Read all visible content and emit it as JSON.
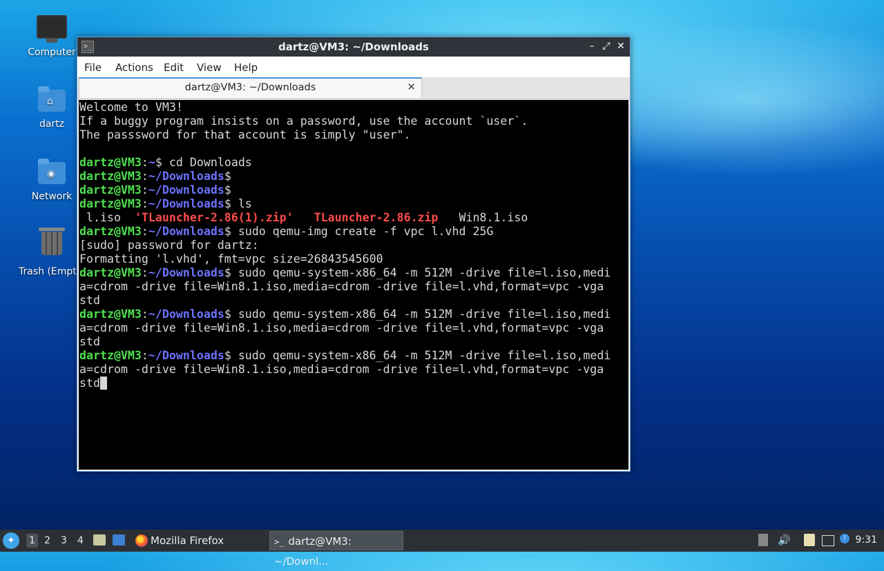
{
  "desktop": {
    "icons": [
      {
        "label": "Computer"
      },
      {
        "label": "dartz"
      },
      {
        "label": "Network"
      },
      {
        "label": "Trash (Empty)"
      }
    ]
  },
  "window": {
    "title": "dartz@VM3: ~/Downloads",
    "menu": [
      "File",
      "Actions",
      "Edit",
      "View",
      "Help"
    ],
    "tab_title": "dartz@VM3: ~/Downloads",
    "controls": {
      "minimize": "–",
      "maximize": "⤢",
      "close": "✕"
    }
  },
  "terminal": {
    "prompt_user": "dartz@VM3",
    "lines": [
      {
        "text": "Welcome to VM3!"
      },
      {
        "text": "If a buggy program insists on a password, use the account `user`."
      },
      {
        "text": "The passsword for that account is simply \"user\"."
      },
      {
        "text": ""
      },
      {
        "path": "~",
        "cmd": " cd Downloads"
      },
      {
        "path": "~/Downloads",
        "cmd": ""
      },
      {
        "path": "~/Downloads",
        "cmd": ""
      },
      {
        "path": "~/Downloads",
        "cmd": " ls"
      },
      {
        "ls": [
          {
            "text": " l.iso  ",
            "style": "plain"
          },
          {
            "text": "'TLauncher-2.86(1).zip'",
            "style": "red"
          },
          {
            "text": "   ",
            "style": "plain"
          },
          {
            "text": "TLauncher-2.86.zip",
            "style": "red"
          },
          {
            "text": "   Win8.1.iso",
            "style": "plain"
          }
        ]
      },
      {
        "path": "~/Downloads",
        "cmd": " sudo qemu-img create -f vpc l.vhd 25G"
      },
      {
        "text": "[sudo] password for dartz:"
      },
      {
        "text": "Formatting 'l.vhd', fmt=vpc size=26843545600"
      },
      {
        "path": "~/Downloads",
        "cmd": " sudo qemu-system-x86_64 -m 512M -drive file=l.iso,medi"
      },
      {
        "text": "a=cdrom -drive file=Win8.1.iso,media=cdrom -drive file=l.vhd,format=vpc -vga"
      },
      {
        "text": "std"
      },
      {
        "path": "~/Downloads",
        "cmd": " sudo qemu-system-x86_64 -m 512M -drive file=l.iso,medi"
      },
      {
        "text": "a=cdrom -drive file=Win8.1.iso,media=cdrom -drive file=l.vhd,format=vpc -vga"
      },
      {
        "text": "std"
      },
      {
        "path": "~/Downloads",
        "cmd": " sudo qemu-system-x86_64 -m 512M -drive file=l.iso,medi"
      },
      {
        "text": "a=cdrom -drive file=Win8.1.iso,media=cdrom -drive file=l.vhd,format=vpc -vga"
      },
      {
        "text": "std",
        "cursor": true
      }
    ]
  },
  "taskbar": {
    "workspaces": [
      "1",
      "2",
      "3",
      "4"
    ],
    "active_workspace": "1",
    "tasks": [
      {
        "label": "Mozilla Firefox",
        "icon": "firefox-icon"
      },
      {
        "label": "dartz@VM3: ~/Downl...",
        "icon": "terminal-icon"
      }
    ],
    "clock": "9:31"
  },
  "colors": {
    "prompt_user": "#4fe04f",
    "prompt_path": "#6b72ff",
    "archive_files": "#ff4c4c",
    "terminal_bg": "#000000",
    "titlebar": "#2f343a",
    "taskbar": "#2c3035"
  }
}
